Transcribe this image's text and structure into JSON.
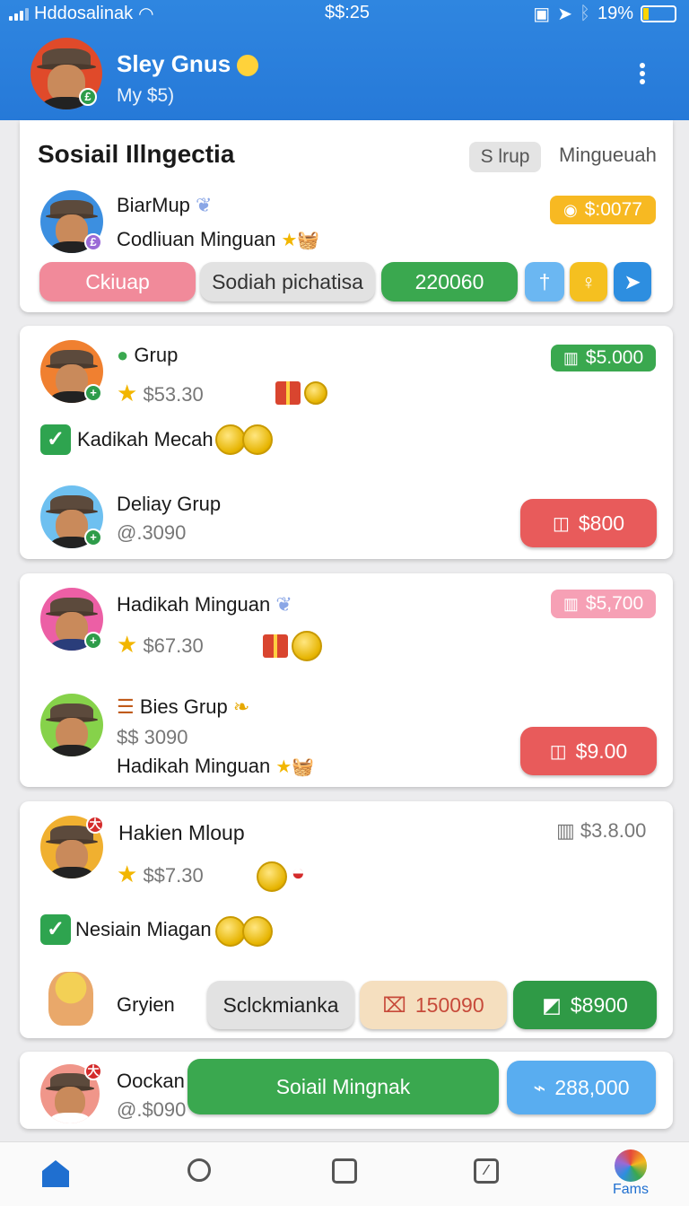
{
  "status_bar": {
    "carrier": "Hddosalinak",
    "time": "$$:25",
    "battery": "19%"
  },
  "header": {
    "user_name": "Sley Gnus",
    "subtitle": "My $5)",
    "menu_icon": "more-vert-icon"
  },
  "card1": {
    "title": "Sosiail Illngectia",
    "tabs": [
      "S lrup",
      "Mingueuah"
    ],
    "user": {
      "name": "BiarMup",
      "subtitle": "Codliuan Minguan",
      "value_badge": "$:0077"
    },
    "actions": [
      "Ckiuap",
      "Sodiah pichatisa",
      "220060"
    ],
    "icon_buttons": [
      "share-icon",
      "gift-icon",
      "send-icon"
    ]
  },
  "card2": {
    "row1": {
      "name": "Grup",
      "value": "$53.30",
      "badge": "$5.000"
    },
    "check_label": "Kadikah Mecah",
    "row2": {
      "name": "Deliay Grup",
      "value": "@.3090",
      "button": "$800"
    }
  },
  "card3": {
    "row1": {
      "name": "Hadikah Minguan",
      "value": "$67.30",
      "badge": "$5,700"
    },
    "row2": {
      "name": "Bies Grup",
      "value": "$$ 3090",
      "subtitle": "Hadikah Minguan",
      "button": "$9.00"
    }
  },
  "card4": {
    "row1": {
      "name": "Hakien Mloup",
      "value": "$$7.30",
      "badge": "$3.8.00"
    },
    "check_label": "Nesiain Miagan",
    "row2": {
      "name": "Gryien",
      "btn1": "Sclckmianka",
      "btn2": "150090",
      "btn3": "$8900"
    }
  },
  "card5": {
    "name": "Oockan",
    "value": "@.$090",
    "main_button": "Soiail Mingnak",
    "amount_button": "288,000"
  },
  "bottom_nav": {
    "items": [
      "home-icon",
      "search-icon",
      "square-icon",
      "edit-icon"
    ],
    "last_label": "Fams"
  },
  "colors": {
    "header": "#2679d8",
    "green": "#3aa84f",
    "red": "#e85b5b",
    "pink": "#f18a9a",
    "blue": "#4aa3f0",
    "yellow": "#f5b91f"
  }
}
